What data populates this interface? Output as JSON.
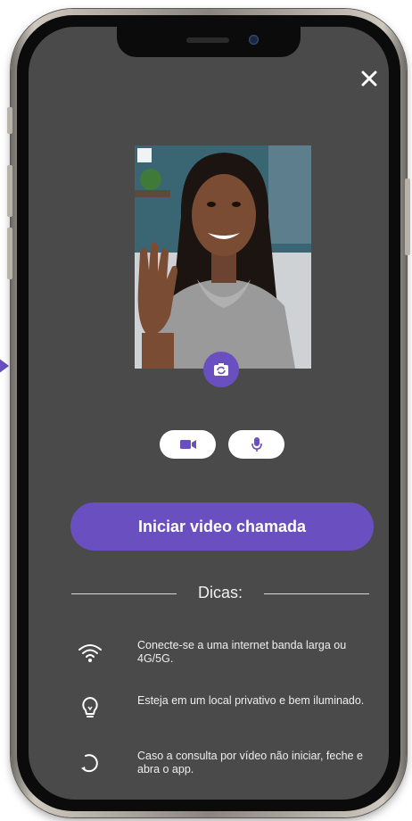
{
  "call": {
    "start_button_label": "Iniciar video chamada"
  },
  "tips": {
    "title": "Dicas:",
    "items": [
      {
        "icon": "wifi-icon",
        "text": "Conecte-se a uma internet banda larga ou 4G/5G."
      },
      {
        "icon": "lightbulb-icon",
        "text": "Esteja em um local privativo e bem iluminado."
      },
      {
        "icon": "refresh-icon",
        "text": "Caso a consulta por vídeo não iniciar, feche e abra o app."
      }
    ]
  },
  "colors": {
    "screen_background": "#4a4a4a",
    "accent": "#6a4fc0",
    "pill_background": "#ffffff",
    "text": "#eeeeee"
  }
}
